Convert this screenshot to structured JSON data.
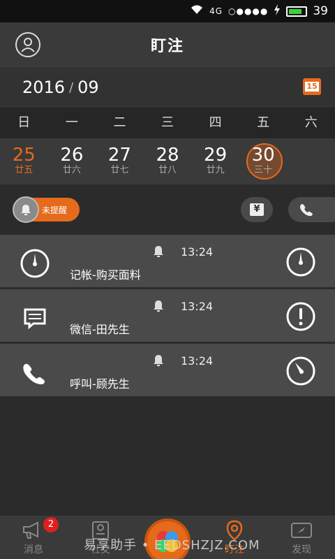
{
  "status": {
    "network": "4G",
    "signal": "○●●●●",
    "battery": "39"
  },
  "header": {
    "title": "盯注"
  },
  "calendar": {
    "year": "2016",
    "sep": "/",
    "month": "09",
    "icon_day": "15",
    "weekdays": [
      "日",
      "一",
      "二",
      "三",
      "四",
      "五",
      "六"
    ],
    "dates": [
      {
        "num": "25",
        "lunar": "廿五"
      },
      {
        "num": "26",
        "lunar": "廿六"
      },
      {
        "num": "27",
        "lunar": "廿七"
      },
      {
        "num": "28",
        "lunar": "廿八"
      },
      {
        "num": "29",
        "lunar": "廿九"
      },
      {
        "num": "30",
        "lunar": "三十"
      }
    ]
  },
  "filter": {
    "toggle_label": "未提醒",
    "money_symbol": "¥"
  },
  "items": [
    {
      "time": "13:24",
      "label": "记帐-购买面料"
    },
    {
      "time": "13:24",
      "label": "微信-田先生"
    },
    {
      "time": "13:24",
      "label": "呼叫-顾先生"
    }
  ],
  "tabbar": {
    "tabs": [
      {
        "label": "消息",
        "badge": "2"
      },
      {
        "label": "社交"
      },
      {
        "label": ""
      },
      {
        "label": "盯注"
      },
      {
        "label": "发现"
      }
    ]
  },
  "watermark": "易享助手 • EEDSHZJZ.COM",
  "colors": {
    "accent": "#e56a1c",
    "background": "#2b2b2b",
    "row": "#4a4a4a"
  }
}
